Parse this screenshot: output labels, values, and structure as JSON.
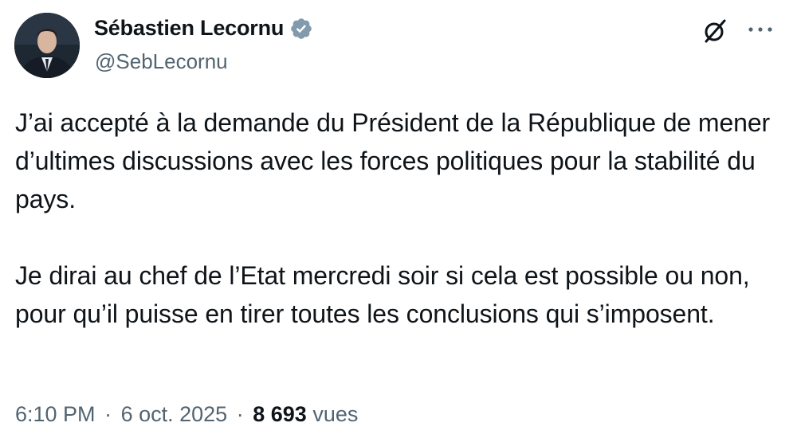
{
  "author": {
    "display_name": "Sébastien Lecornu",
    "handle": "@SebLecornu",
    "verified_badge_color": "#829aab"
  },
  "actions": {
    "grok_icon": "grok-icon",
    "more_icon": "more-horizontal-icon"
  },
  "tweet": {
    "paragraphs": [
      "J’ai accepté à la demande du Président de la République de mener d’ultimes discussions avec les forces politiques pour la stabilité du pays.",
      "Je dirai au chef de l’Etat mercredi soir si cela est possible ou non, pour qu’il puisse en tirer toutes les conclusions qui s’imposent."
    ]
  },
  "meta": {
    "time": "6:10 PM",
    "separator": "·",
    "date": "6 oct. 2025",
    "views_count": "8 693",
    "views_label": "vues"
  },
  "colors": {
    "text_primary": "#0f1419",
    "text_secondary": "#536471",
    "background": "#ffffff"
  }
}
